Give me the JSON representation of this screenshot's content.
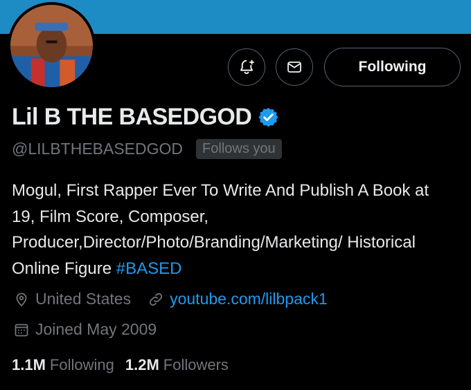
{
  "header": {
    "banner_color": "#1d8cc4"
  },
  "actions": {
    "notify_icon": "bell-plus-icon",
    "message_icon": "envelope-icon",
    "follow_label": "Following"
  },
  "profile": {
    "name": "Lil B THE BASEDGOD",
    "verified": true,
    "handle": "@LILBTHEBASEDGOD",
    "follows_you": "Follows you",
    "bio_text": "Mogul, First Rapper Ever To Write And Publish A Book at 19, Film Score, Composer, Producer,Director/Photo/Branding/Marketing/ Historical Online Figure ",
    "bio_hashtag": "#BASED",
    "location": "United States",
    "website": "youtube.com/lilbpack1",
    "joined": "Joined May 2009"
  },
  "stats": {
    "following_count": "1.1M",
    "following_label": "Following",
    "followers_count": "1.2M",
    "followers_label": "Followers"
  },
  "colors": {
    "accent": "#1d9bf0",
    "muted": "#71767b",
    "text": "#e7e9ea",
    "background": "#000000"
  }
}
